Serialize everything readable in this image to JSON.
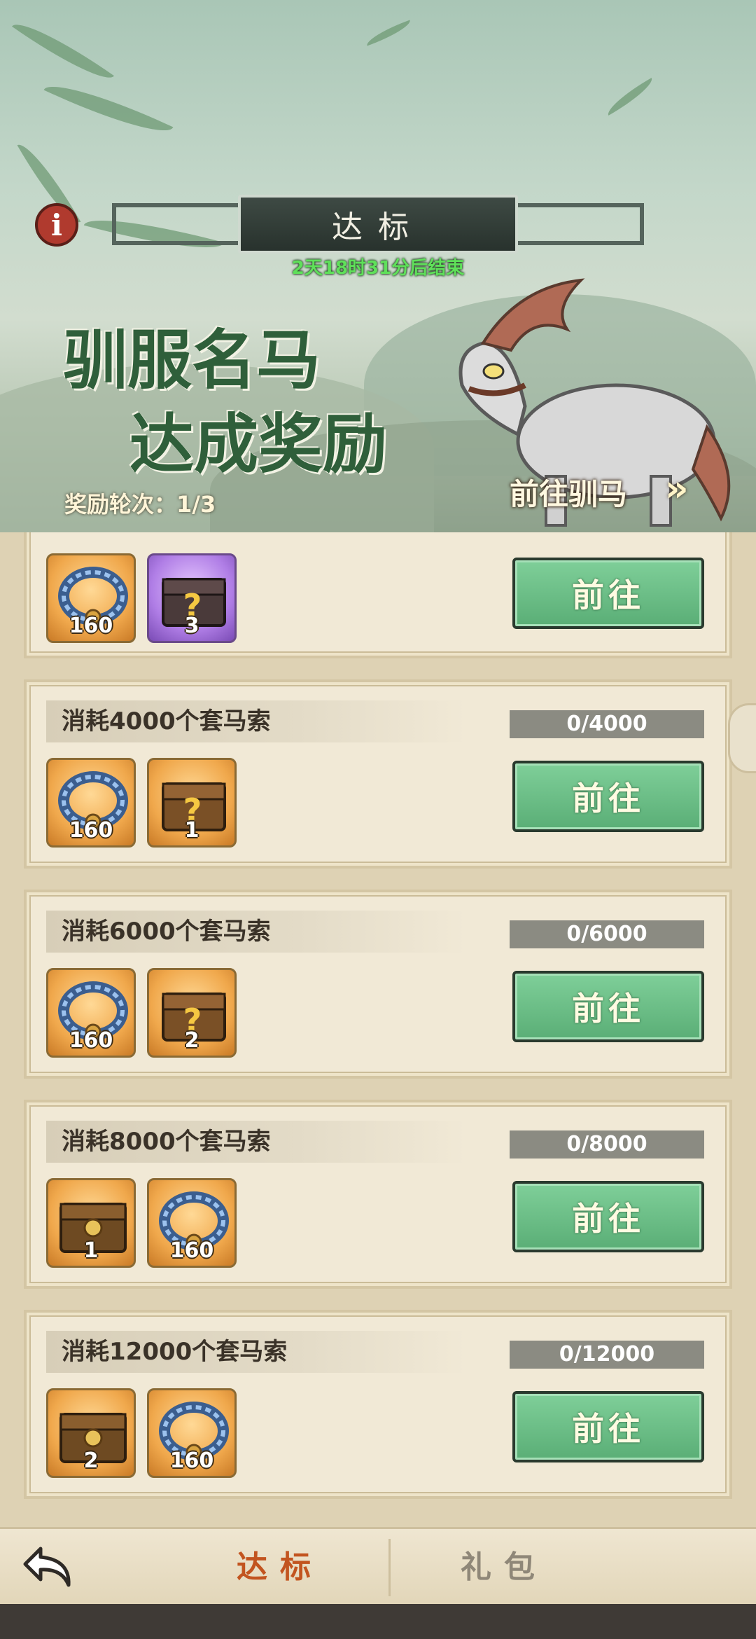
{
  "header": {
    "title": "达标",
    "countdown": "2天18时31分后结束",
    "headline_line1": "驯服名马",
    "headline_line2": "达成奖励",
    "round_info": "奖励轮次：1/3",
    "go_horse_label": "前往驯马",
    "go_horse_arrow": "»",
    "info_icon": "i"
  },
  "tasks": [
    {
      "title": "",
      "progress": "",
      "button": "前往",
      "rewards": [
        {
          "icon": "rope-icon",
          "count": "160",
          "rarity": "orange"
        },
        {
          "icon": "mystery-chest-icon",
          "count": "3",
          "rarity": "purple"
        }
      ]
    },
    {
      "title": "消耗4000个套马索",
      "progress": "0/4000",
      "button": "前往",
      "rewards": [
        {
          "icon": "rope-icon",
          "count": "160",
          "rarity": "orange"
        },
        {
          "icon": "mystery-chest-icon",
          "count": "1",
          "rarity": "orange"
        }
      ]
    },
    {
      "title": "消耗6000个套马索",
      "progress": "0/6000",
      "button": "前往",
      "rewards": [
        {
          "icon": "rope-icon",
          "count": "160",
          "rarity": "orange"
        },
        {
          "icon": "mystery-chest-icon",
          "count": "2",
          "rarity": "orange"
        }
      ]
    },
    {
      "title": "消耗8000个套马索",
      "progress": "0/8000",
      "button": "前往",
      "rewards": [
        {
          "icon": "chest-icon",
          "count": "1",
          "rarity": "orange"
        },
        {
          "icon": "rope-icon",
          "count": "160",
          "rarity": "orange"
        }
      ]
    },
    {
      "title": "消耗12000个套马索",
      "progress": "0/12000",
      "button": "前往",
      "rewards": [
        {
          "icon": "chest-icon",
          "count": "2",
          "rarity": "orange"
        },
        {
          "icon": "rope-icon",
          "count": "160",
          "rarity": "orange"
        }
      ]
    }
  ],
  "bottom_nav": {
    "tabs": [
      {
        "label": "达标",
        "active": true
      },
      {
        "label": "礼包",
        "active": false
      }
    ]
  },
  "colors": {
    "button_green": "#5aae76",
    "active_tab": "#c2541f",
    "countdown_green": "#5fe05a",
    "headline_green": "#2f5f3a"
  }
}
